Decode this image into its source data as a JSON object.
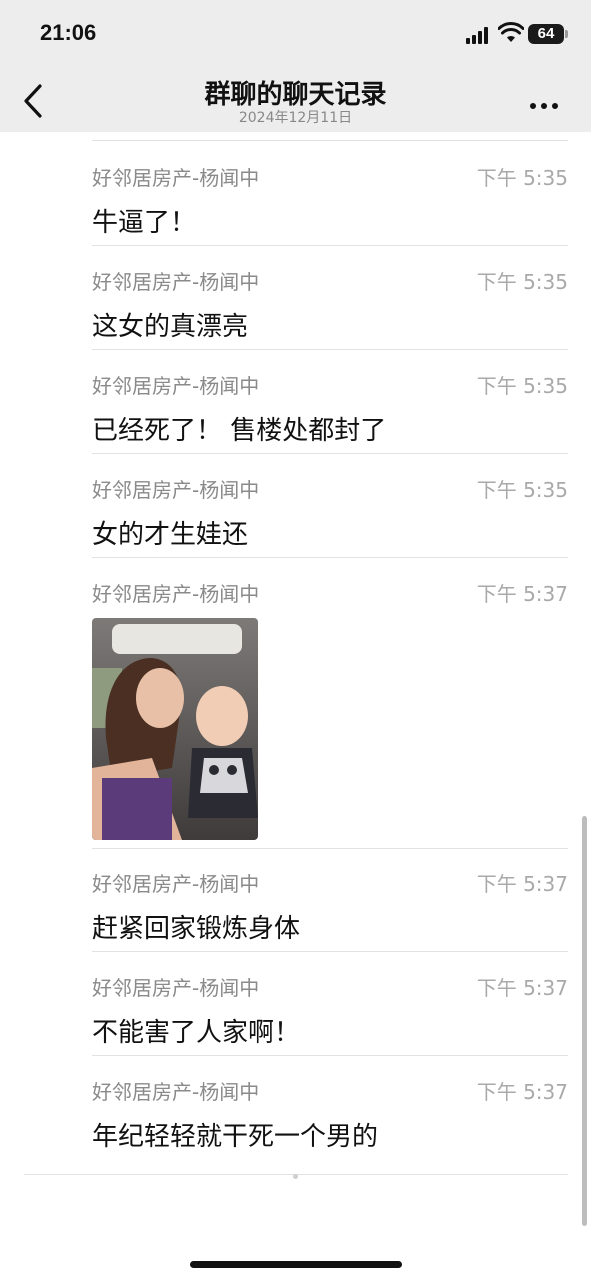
{
  "status_bar": {
    "time": "21:06",
    "battery": "64"
  },
  "nav": {
    "title": "群聊的聊天记录",
    "subtitle": "2024年12月11日"
  },
  "messages": [
    {
      "sender": "好邻居房产-杨闻中",
      "time": "下午 5:35",
      "text": "牛逼了！"
    },
    {
      "sender": "好邻居房产-杨闻中",
      "time": "下午 5:35",
      "text": "这女的真漂亮"
    },
    {
      "sender": "好邻居房产-杨闻中",
      "time": "下午 5:35",
      "text": "已经死了！ 售楼处都封了"
    },
    {
      "sender": "好邻居房产-杨闻中",
      "time": "下午 5:35",
      "text": "女的才生娃还"
    },
    {
      "sender": "好邻居房产-杨闻中",
      "time": "下午 5:37",
      "image": "photo-of-woman-and-baby-in-car"
    },
    {
      "sender": "好邻居房产-杨闻中",
      "time": "下午 5:37",
      "text": "赶紧回家锻炼身体"
    },
    {
      "sender": "好邻居房产-杨闻中",
      "time": "下午 5:37",
      "text": "不能害了人家啊！"
    },
    {
      "sender": "好邻居房产-杨闻中",
      "time": "下午 5:37",
      "text": "年纪轻轻就干死一个男的"
    }
  ],
  "icons": {
    "back": "chevron-left-icon",
    "more": "more-dots-icon",
    "signal": "cellular-signal-icon",
    "wifi": "wifi-icon"
  },
  "colors": {
    "header_bg": "#ededed",
    "sender": "#8a8a8a",
    "time": "#a9a9a9"
  }
}
